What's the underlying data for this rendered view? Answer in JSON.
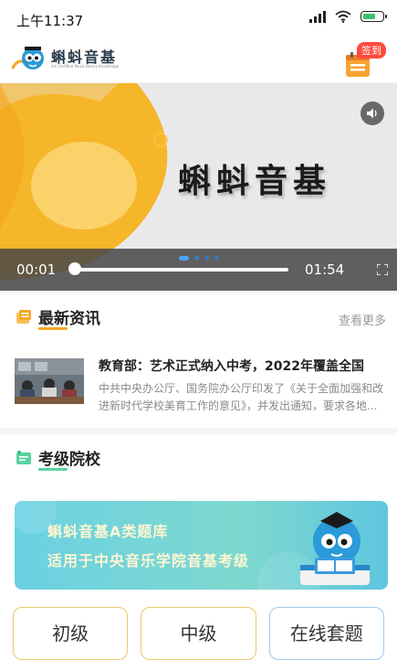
{
  "status_bar": {
    "time": "上午11:37"
  },
  "header": {
    "app_name": "蝌蚪音基",
    "app_subtitle": "Art Certified Music Basics Knowledge",
    "checkin_label": "签到"
  },
  "video": {
    "title_text": "蝌蚪音基",
    "current_time": "00:01",
    "duration": "01:54",
    "progress": 0.01,
    "slide_count": 4,
    "active_slide": 0
  },
  "news": {
    "title": "最新资讯",
    "more_label": "查看更多",
    "items": [
      {
        "title": "教育部：艺术正式纳入中考，2022年覆盖全国",
        "desc": "中共中央办公厅、国务院办公厅印发了《关于全面加强和改进新时代学校美育工作的意见》，并发出通知，要求各地..."
      }
    ]
  },
  "schools": {
    "title": "考级院校",
    "banner": {
      "line1": "蝌蚪音基A类题库",
      "line2": "适用于中央音乐学院音基考级"
    },
    "levels": [
      "初级",
      "中级",
      "在线套题"
    ]
  },
  "colors": {
    "accent": "#f5a623",
    "brand_blue": "#2d7fd3",
    "badge_red": "#ff4a3d"
  }
}
